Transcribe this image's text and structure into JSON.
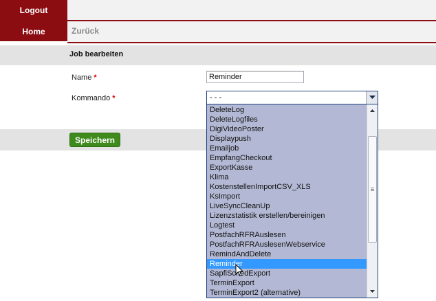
{
  "nav": {
    "logout_label": "Logout",
    "home_label": "Home"
  },
  "toolbar": {
    "back_label": "Zurück"
  },
  "form": {
    "title": "Job bearbeiten",
    "name_label": "Name",
    "kommando_label": "Kommando",
    "required_mark": "*",
    "name_value": "Reminder",
    "kommando_selected": "- - -",
    "save_label": "Speichern"
  },
  "dropdown": {
    "options": [
      "DeleteLog",
      "DeleteLogfiles",
      "DigiVideoPoster",
      "Displaypush",
      "Emailjob",
      "EmpfangCheckout",
      "ExportKasse",
      "Klima",
      "KostenstellenImportCSV_XLS",
      "KsImport",
      "LiveSyncCleanUp",
      "Lizenzstatistik erstellen/bereinigen",
      "Logtest",
      "PostfachRFRAuslesen",
      "PostfachRFRAuslesenWebservice",
      "RemindAndDelete",
      "Reminder",
      "SapfiSchedExport",
      "TerminExport",
      "TerminExport2 (alternative)"
    ],
    "highlighted_index": 16
  },
  "colors": {
    "nav_red": "#8b0d12",
    "save_green": "#3e8a1c",
    "highlight_blue": "#3399ff",
    "list_background": "#b3b9d4"
  },
  "icons": {
    "select_arrow": "chevron-down-icon",
    "cursor": "mouse-pointer-icon"
  }
}
